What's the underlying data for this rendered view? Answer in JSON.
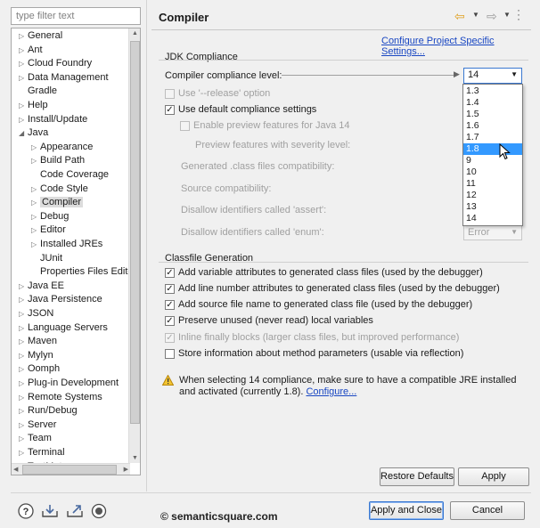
{
  "filter": {
    "placeholder": "type filter text"
  },
  "tree": {
    "items": [
      {
        "label": "General",
        "level": 0,
        "twisty": "closed"
      },
      {
        "label": "Ant",
        "level": 0,
        "twisty": "closed"
      },
      {
        "label": "Cloud Foundry",
        "level": 0,
        "twisty": "closed"
      },
      {
        "label": "Data Management",
        "level": 0,
        "twisty": "closed"
      },
      {
        "label": "Gradle",
        "level": 0,
        "twisty": "none"
      },
      {
        "label": "Help",
        "level": 0,
        "twisty": "closed"
      },
      {
        "label": "Install/Update",
        "level": 0,
        "twisty": "closed"
      },
      {
        "label": "Java",
        "level": 0,
        "twisty": "open"
      },
      {
        "label": "Appearance",
        "level": 1,
        "twisty": "closed"
      },
      {
        "label": "Build Path",
        "level": 1,
        "twisty": "closed"
      },
      {
        "label": "Code Coverage",
        "level": 1,
        "twisty": "none"
      },
      {
        "label": "Code Style",
        "level": 1,
        "twisty": "closed"
      },
      {
        "label": "Compiler",
        "level": 1,
        "twisty": "closed",
        "selected": true
      },
      {
        "label": "Debug",
        "level": 1,
        "twisty": "closed"
      },
      {
        "label": "Editor",
        "level": 1,
        "twisty": "closed"
      },
      {
        "label": "Installed JREs",
        "level": 1,
        "twisty": "closed"
      },
      {
        "label": "JUnit",
        "level": 1,
        "twisty": "none"
      },
      {
        "label": "Properties Files Editor",
        "level": 1,
        "twisty": "none"
      },
      {
        "label": "Java EE",
        "level": 0,
        "twisty": "closed"
      },
      {
        "label": "Java Persistence",
        "level": 0,
        "twisty": "closed"
      },
      {
        "label": "JSON",
        "level": 0,
        "twisty": "closed"
      },
      {
        "label": "Language Servers",
        "level": 0,
        "twisty": "closed"
      },
      {
        "label": "Maven",
        "level": 0,
        "twisty": "closed"
      },
      {
        "label": "Mylyn",
        "level": 0,
        "twisty": "closed"
      },
      {
        "label": "Oomph",
        "level": 0,
        "twisty": "closed"
      },
      {
        "label": "Plug-in Development",
        "level": 0,
        "twisty": "closed"
      },
      {
        "label": "Remote Systems",
        "level": 0,
        "twisty": "closed"
      },
      {
        "label": "Run/Debug",
        "level": 0,
        "twisty": "closed"
      },
      {
        "label": "Server",
        "level": 0,
        "twisty": "closed"
      },
      {
        "label": "Team",
        "level": 0,
        "twisty": "closed"
      },
      {
        "label": "Terminal",
        "level": 0,
        "twisty": "closed"
      },
      {
        "label": "TextMate",
        "level": 0,
        "twisty": "closed"
      }
    ]
  },
  "header": {
    "title": "Compiler"
  },
  "configure_link": "Configure Project Specific Settings...",
  "jdk": {
    "section_title": "JDK Compliance",
    "level_label": "Compiler compliance level:",
    "level_value": "14",
    "release_option": "Use '--release' option",
    "use_default": "Use default compliance settings",
    "enable_preview": "Enable preview features for Java 14",
    "preview_severity": "Preview features with severity level:",
    "class_compat": "Generated .class files compatibility:",
    "source_compat": "Source compatibility:",
    "disallow_assert": "Disallow identifiers called 'assert':",
    "disallow_enum": "Disallow identifiers called 'enum':",
    "enum_value": "Error"
  },
  "dropdown": {
    "options": [
      "1.3",
      "1.4",
      "1.5",
      "1.6",
      "1.7",
      "1.8",
      "9",
      "10",
      "11",
      "12",
      "13",
      "14"
    ],
    "highlighted": "1.8"
  },
  "classfile": {
    "section_title": "Classfile Generation",
    "options": [
      {
        "label": "Add variable attributes to generated class files (used by the debugger)",
        "checked": true,
        "enabled": true
      },
      {
        "label": "Add line number attributes to generated class files (used by the debugger)",
        "checked": true,
        "enabled": true
      },
      {
        "label": "Add source file name to generated class file (used by the debugger)",
        "checked": true,
        "enabled": true
      },
      {
        "label": "Preserve unused (never read) local variables",
        "checked": true,
        "enabled": true
      },
      {
        "label": "Inline finally blocks (larger class files, but improved performance)",
        "checked": true,
        "enabled": false
      },
      {
        "label": "Store information about method parameters (usable via reflection)",
        "checked": false,
        "enabled": true
      }
    ]
  },
  "warning": {
    "text": "When selecting 14 compliance, make sure to have a compatible JRE installed and activated (currently 1.8).",
    "link": "Configure..."
  },
  "buttons": {
    "restore_defaults": "Restore Defaults",
    "apply": "Apply",
    "apply_and_close": "Apply and Close",
    "cancel": "Cancel"
  },
  "watermark": "© semanticsquare.com",
  "colors": {
    "link": "#1846c2",
    "selection": "#3399ff",
    "warning": "#e8b020"
  }
}
